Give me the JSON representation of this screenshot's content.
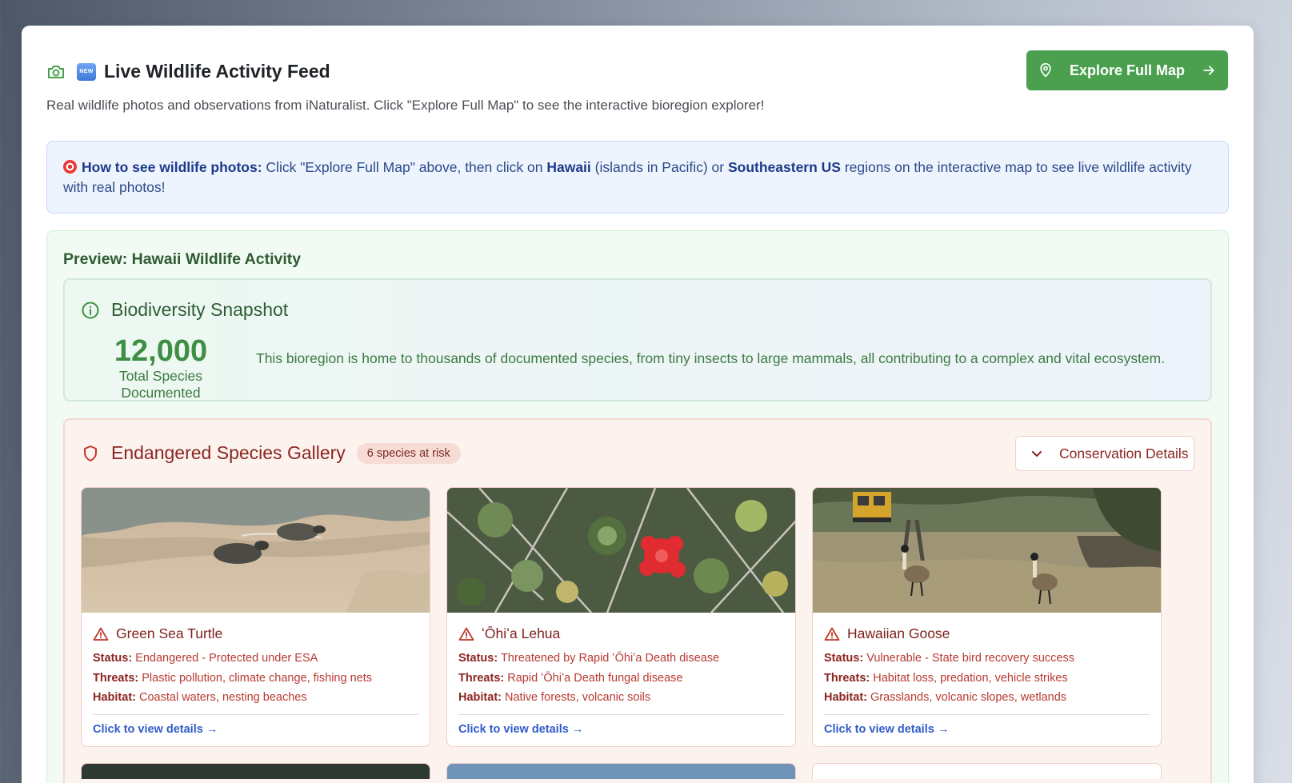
{
  "header": {
    "title": "Live Wildlife Activity Feed",
    "new_badge": "NEW",
    "subtitle": "Real wildlife photos and observations from iNaturalist. Click \"Explore Full Map\" to see the interactive bioregion explorer!",
    "explore_button": "Explore Full Map"
  },
  "howto": {
    "bold_lead": "How to see wildlife photos:",
    "text1": " Click \"Explore Full Map\" above, then click on ",
    "region1": "Hawaii",
    "text2": " (islands in Pacific) or ",
    "region2": "Southeastern US",
    "text3": " regions on the interactive map to see live wildlife activity with real photos!"
  },
  "preview": {
    "title": "Preview: Hawaii Wildlife Activity",
    "snapshot": {
      "title": "Biodiversity Snapshot",
      "count": "12,000",
      "count_label": "Total Species Documented",
      "description": "This bioregion is home to thousands of documented species, from tiny insects to large mammals, all contributing to a complex and vital ecosystem."
    },
    "endangered": {
      "title": "Endangered Species Gallery",
      "badge": "6 species at risk",
      "details_button": "Conservation Details",
      "labels": {
        "status": "Status:",
        "threats": "Threats:",
        "habitat": "Habitat:"
      },
      "cards": [
        {
          "name": "Green Sea Turtle",
          "status": "Endangered - Protected under ESA",
          "threats": "Plastic pollution, climate change, fishing nets",
          "habitat": "Coastal waters, nesting beaches",
          "link": "Click to view details →"
        },
        {
          "name": "ʻŌhiʻa Lehua",
          "status": "Threatened by Rapid ʻŌhiʻa Death disease",
          "threats": "Rapid ʻŌhiʻa Death fungal disease",
          "habitat": "Native forests, volcanic soils",
          "link": "Click to view details →"
        },
        {
          "name": "Hawaiian Goose",
          "status": "Vulnerable - State bird recovery success",
          "threats": "Habitat loss, predation, vehicle strikes",
          "habitat": "Grasslands, volcanic slopes, wetlands",
          "link": "Click to view details →"
        }
      ]
    }
  },
  "colors": {
    "primary_green": "#4aa04e",
    "danger_red": "#8c2521",
    "link_blue": "#2f5bc8",
    "info_blue": "#1d3a8a"
  }
}
